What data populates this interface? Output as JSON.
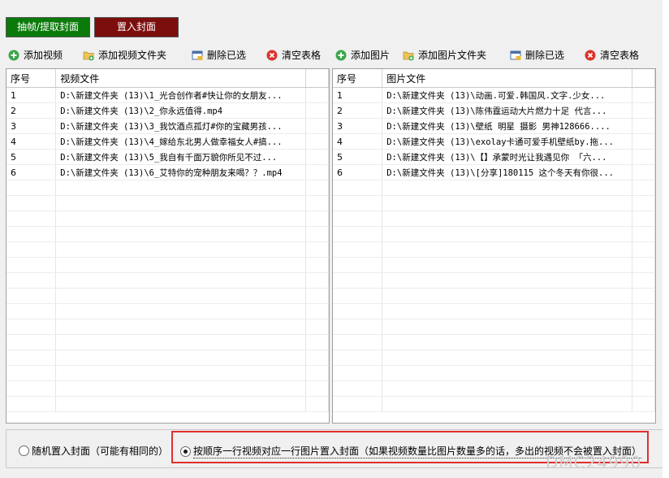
{
  "tabs": {
    "extract": "抽帧/提取封面",
    "insert": "置入封面"
  },
  "left_toolbar": {
    "add_video": "添加视频",
    "add_video_folder": "添加视频文件夹",
    "delete_selected": "删除已选",
    "clear_table": "清空表格"
  },
  "right_toolbar": {
    "add_image": "添加图片",
    "add_image_folder": "添加图片文件夹",
    "delete_selected": "删除已选",
    "clear_table": "清空表格"
  },
  "video_table": {
    "headers": [
      "序号",
      "视频文件"
    ],
    "rows": [
      [
        "1",
        "D:\\新建文件夹 (13)\\1_光合创作者#快让你的女朋友..."
      ],
      [
        "2",
        "D:\\新建文件夹 (13)\\2_你永远值得.mp4"
      ],
      [
        "3",
        "D:\\新建文件夹 (13)\\3_我饮酒点孤灯#你的宝藏男孩..."
      ],
      [
        "4",
        "D:\\新建文件夹 (13)\\4_嫁给东北男人做幸福女人#搞..."
      ],
      [
        "5",
        "D:\\新建文件夹 (13)\\5_我自有千面万貌你所见不过..."
      ],
      [
        "6",
        "D:\\新建文件夹 (13)\\6_艾特你的宠种朋友来喝？？.mp4"
      ]
    ]
  },
  "image_table": {
    "headers": [
      "序号",
      "图片文件"
    ],
    "rows": [
      [
        "1",
        "D:\\新建文件夹 (13)\\动画.可爱.韩国风.文字.少女..."
      ],
      [
        "2",
        "D:\\新建文件夹 (13)\\陈伟霆运动大片燃力十足 代言..."
      ],
      [
        "3",
        "D:\\新建文件夹 (13)\\壁纸  明星 摄影 男神128666...."
      ],
      [
        "4",
        "D:\\新建文件夹 (13)\\exolay卡通可爱手机壁纸by.拖..."
      ],
      [
        "5",
        "D:\\新建文件夹 (13)\\【】承蒙时光让我遇见你 「六..."
      ],
      [
        "6",
        "D:\\新建文件夹 (13)\\[分享]180115 这个冬天有你很..."
      ]
    ]
  },
  "options": {
    "random": "随机置入封面（可能有相同的）",
    "ordered": "按顺序一行视频对应一行图片置入封面（如果视频数量比图片数量多的话，多出的视频不会被置入封面）",
    "selected": "ordered"
  },
  "watermark": "DMC24990",
  "colors": {
    "tab_extract": "#0a7a0a",
    "tab_insert": "#7d0e0e",
    "highlight": "#e0302e"
  }
}
